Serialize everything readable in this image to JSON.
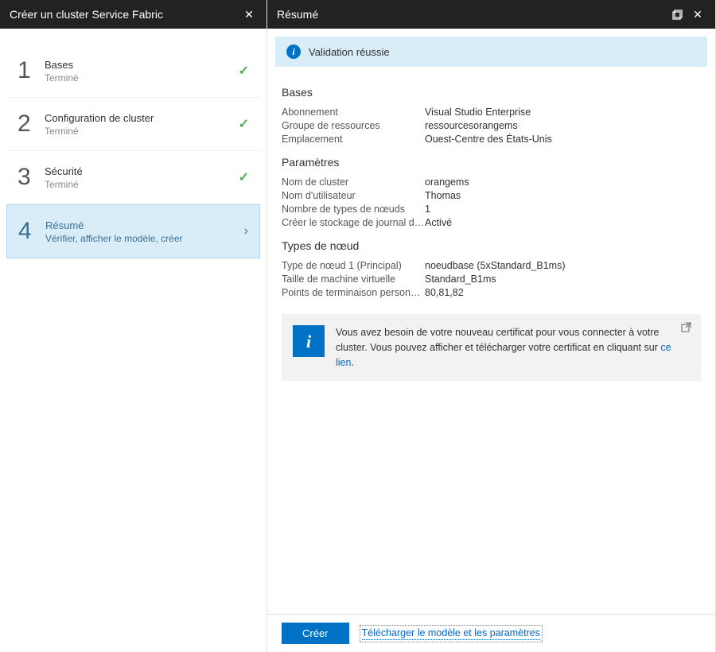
{
  "leftBlade": {
    "title": "Créer un cluster Service Fabric",
    "steps": [
      {
        "num": "1",
        "name": "Bases",
        "sub": "Terminé",
        "done": true
      },
      {
        "num": "2",
        "name": "Configuration de cluster",
        "sub": "Terminé",
        "done": true
      },
      {
        "num": "3",
        "name": "Sécurité",
        "sub": "Terminé",
        "done": true
      },
      {
        "num": "4",
        "name": "Résumé",
        "sub": "Vérifier, afficher le modèle, créer",
        "active": true
      }
    ]
  },
  "rightBlade": {
    "title": "Résumé",
    "validation": "Validation réussie",
    "sections": {
      "bases": {
        "title": "Bases",
        "rows": [
          {
            "label": "Abonnement",
            "value": "Visual Studio Enterprise"
          },
          {
            "label": "Groupe de ressources",
            "value": "ressourcesorangems"
          },
          {
            "label": "Emplacement",
            "value": "Ouest-Centre des États-Unis"
          }
        ]
      },
      "parametres": {
        "title": "Paramètres",
        "rows": [
          {
            "label": "Nom de cluster",
            "value": "orangems"
          },
          {
            "label": "Nom d'utilisateur",
            "value": "Thomas"
          },
          {
            "label": "Nombre de types de nœuds",
            "value": "1"
          },
          {
            "label": "Créer le stockage de journal d'a…",
            "value": "Activé"
          }
        ]
      },
      "types": {
        "title": "Types de nœud",
        "rows": [
          {
            "label": "Type de nœud 1 (Principal)",
            "value": "noeudbase (5xStandard_B1ms)"
          },
          {
            "label": "Taille de machine virtuelle",
            "value": "Standard_B1ms"
          },
          {
            "label": "Points de terminaison personn…",
            "value": "80,81,82"
          }
        ]
      }
    },
    "certBox": {
      "text1": "Vous avez besoin de votre nouveau certificat pour vous connecter à votre cluster. Vous pouvez afficher et télécharger votre certificat en cliquant sur ",
      "link": "ce lien",
      "text2": "."
    },
    "footer": {
      "create": "Créer",
      "download": "Télécharger le modèle et les paramètres"
    }
  }
}
